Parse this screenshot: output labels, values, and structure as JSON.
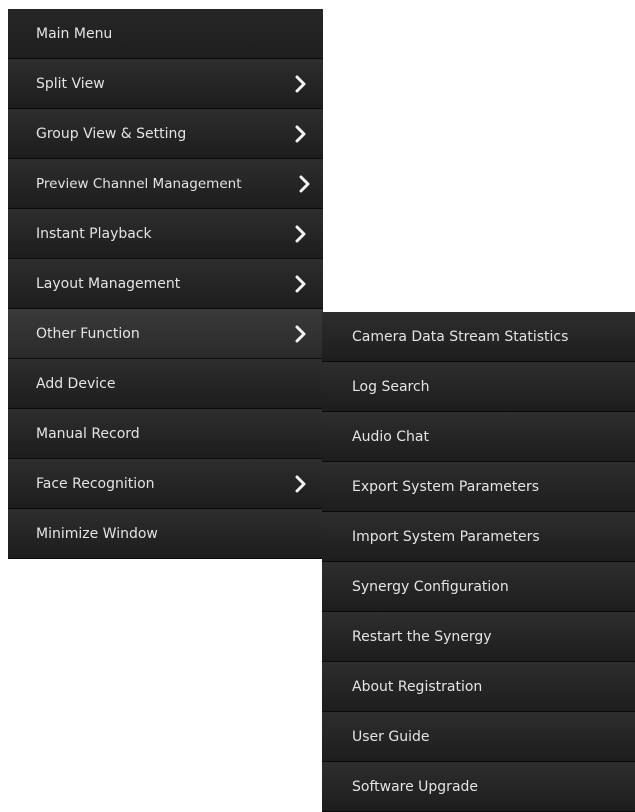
{
  "main_menu": {
    "items": [
      {
        "label": "Main Menu",
        "has_submenu": false
      },
      {
        "label": "Split View",
        "has_submenu": true
      },
      {
        "label": "Group View & Setting",
        "has_submenu": true
      },
      {
        "label": "Preview Channel Management",
        "has_submenu": true
      },
      {
        "label": "Instant Playback",
        "has_submenu": true
      },
      {
        "label": "Layout Management",
        "has_submenu": true
      },
      {
        "label": "Other Function",
        "has_submenu": true
      },
      {
        "label": "Add Device",
        "has_submenu": false
      },
      {
        "label": "Manual Record",
        "has_submenu": false
      },
      {
        "label": "Face Recognition",
        "has_submenu": true
      },
      {
        "label": "Minimize Window",
        "has_submenu": false
      }
    ]
  },
  "submenu": {
    "items": [
      {
        "label": "Camera Data Stream Statistics"
      },
      {
        "label": "Log Search"
      },
      {
        "label": "Audio Chat"
      },
      {
        "label": "Export System Parameters"
      },
      {
        "label": "Import System Parameters"
      },
      {
        "label": "Synergy Configuration"
      },
      {
        "label": "Restart the Synergy"
      },
      {
        "label": "About Registration"
      },
      {
        "label": "User Guide"
      },
      {
        "label": "Software Upgrade"
      }
    ]
  },
  "icons": {
    "submenu_arrow": "chevron-right-icon"
  },
  "colors": {
    "menu_background": "#1c1c1c",
    "text": "#e4e4e4"
  }
}
